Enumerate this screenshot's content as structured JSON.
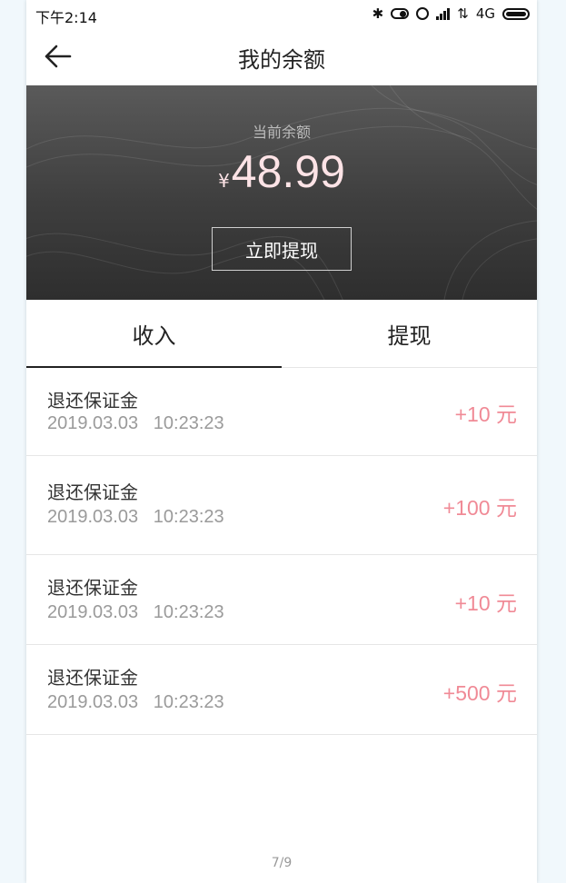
{
  "status_bar": {
    "time": "下午2:14",
    "network": "4G",
    "icons": [
      "bluetooth-icon",
      "toggle-icon",
      "alarm-icon",
      "signal-icon",
      "data-arrows-icon",
      "battery-icon"
    ]
  },
  "nav": {
    "title": "我的余额",
    "back_icon": "arrow-left-icon"
  },
  "balance_card": {
    "label": "当前余额",
    "currency": "¥",
    "amount": "48.99",
    "withdraw_button": "立即提现",
    "amount_color": "#fde3e6"
  },
  "tabs": [
    {
      "label": "收入",
      "active": true
    },
    {
      "label": "提现",
      "active": false
    }
  ],
  "transactions": [
    {
      "title": "退还保证金",
      "date": "2019.03.03",
      "time": "10:23:23",
      "amount": "+10 元"
    },
    {
      "title": "退还保证金",
      "date": "2019.03.03",
      "time": "10:23:23",
      "amount": "+100 元"
    },
    {
      "title": "退还保证金",
      "date": "2019.03.03",
      "time": "10:23:23",
      "amount": "+10 元"
    },
    {
      "title": "退还保证金",
      "date": "2019.03.03",
      "time": "10:23:23",
      "amount": "+500 元"
    }
  ],
  "pager": "7/9",
  "colors": {
    "accent_amount": "#f08a96",
    "card_dark": "#3e3e3e"
  }
}
